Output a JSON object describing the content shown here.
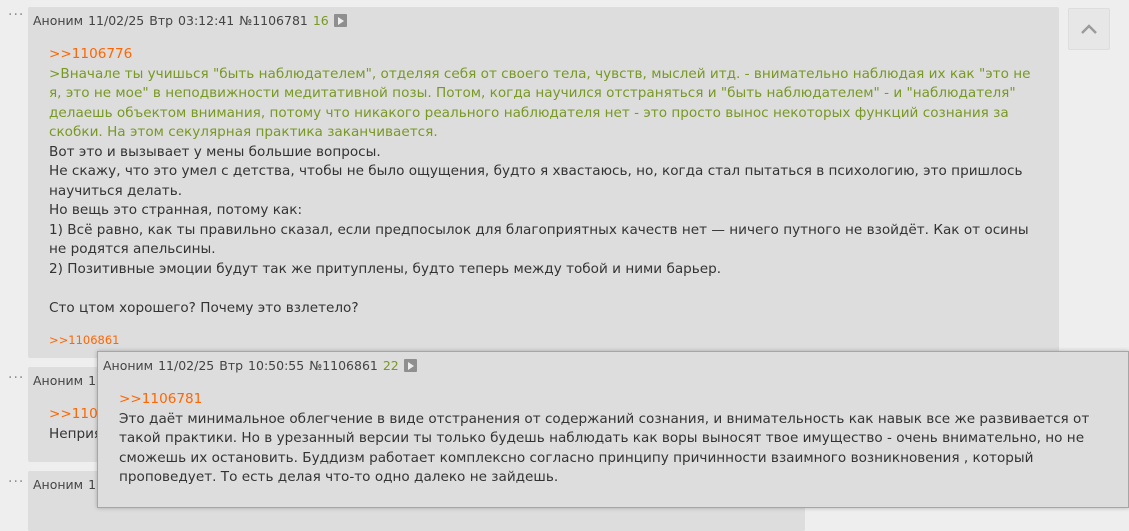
{
  "posts": [
    {
      "author": "Аноним",
      "date": "11/02/25",
      "weekday": "Втр",
      "time": "03:12:41",
      "number": "№1106781",
      "replies": "16",
      "reply_to": ">>1106776",
      "quote": ">Вначале ты учишься \"быть наблюдателем\", отделяя себя от своего тела, чувств, мыслей итд. - внимательно наблюдая их как \"это не я, это не мое\" в неподвижности медитативной позы. Потом, когда научился отстраняться и \"быть наблюдателем\" - и \"наблюдателя\" делаешь объектом внимания, потому что никакого реального наблюдателя нет - это просто вынос некоторых функций сознания за скобки. На этом секулярная практика заканчивается.",
      "lines": [
        "Вот это и вызывает у мены большие вопросы.",
        "Не скажу, что это умел с детства, чтобы не было ощущения, будто я хвастаюсь, но, когда стал пытаться в психологию, это пришлось научиться делать.",
        "Но вещь это странная, потому как:",
        "1) Всё равно, как ты правильно сказал, если предпосылок для благоприятных качеств нет — ничего путного не взойдёт. Как от осины не родятся апельсины.",
        "2) Позитивные эмоции будут так же притуплены, будто теперь между тобой и ними барьер."
      ],
      "last_line": "Сто цтом хорошего? Почему это взлетело?",
      "backlink": ">>1106861"
    },
    {
      "author": "Аноним",
      "date_partial": "11",
      "reply_partial": ">>1106",
      "text_partial": "Неприя"
    },
    {
      "author": "Аноним",
      "date_partial": "11"
    }
  ],
  "preview": {
    "author": "Аноним",
    "date": "11/02/25",
    "weekday": "Втр",
    "time": "10:50:55",
    "number": "№1106861",
    "replies": "22",
    "reply_to": ">>1106781",
    "text": "Это даёт минимальное облегчение в виде отстранения от содержаний сознания, и внимательность как навык все же развивается от такой практики. Но в урезанный версии ты только будешь наблюдать как воры выносят твое имущество - очень внимательно, но не сможешь их остановить. Буддизм работает комплексно согласно принципу причинности взаимного возникновения , который проповедует. То есть делая что-то одно далеко не зайдешь."
  },
  "controls": {
    "dots": "···",
    "scroll_top_icon": "chevron-up-icon"
  },
  "colors": {
    "quote": "#789922",
    "reflink": "#ff6600",
    "post_bg": "#dddddd",
    "page_bg": "#eeeeee"
  }
}
